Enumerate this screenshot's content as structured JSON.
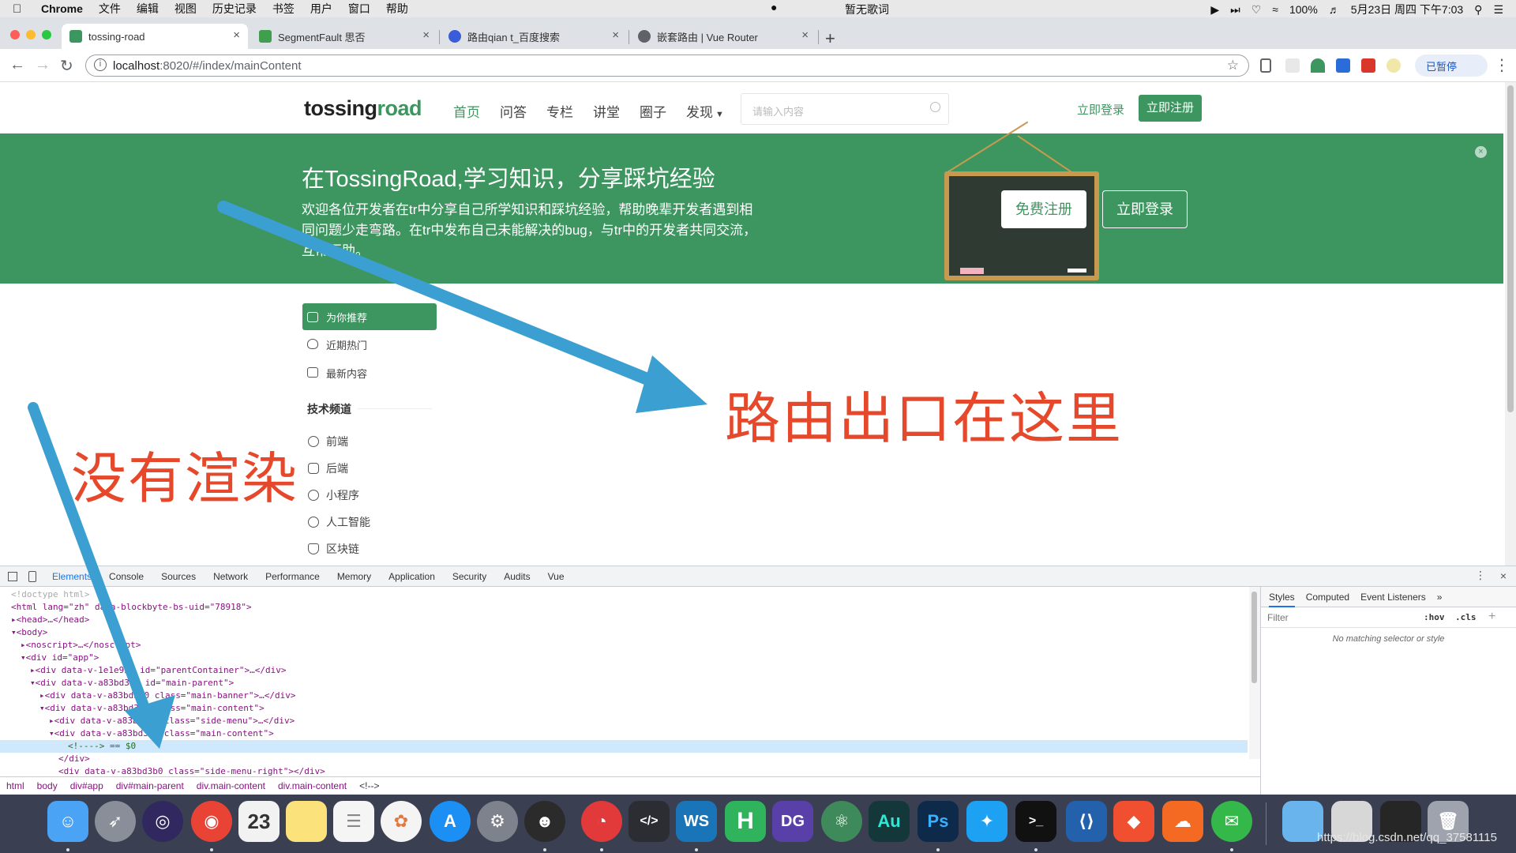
{
  "menubar": {
    "items": [
      "Chrome",
      "文件",
      "编辑",
      "视图",
      "历史记录",
      "书签",
      "用户",
      "窗口",
      "帮助"
    ],
    "center_text": "暂无歌词",
    "battery": "100%",
    "datetime": "5月23日 周四 下午7:03"
  },
  "tabs": [
    {
      "title": "tossing-road",
      "favicon_color": "#3d9660"
    },
    {
      "title": "SegmentFault 思否",
      "favicon_color": "#3f9f4f"
    },
    {
      "title": "路由qian t_百度搜索",
      "favicon_color": "#3b5cd8"
    },
    {
      "title": "嵌套路由 | Vue Router",
      "favicon_color": "#5f6368"
    }
  ],
  "toolbar": {
    "url_host": "localhost",
    "url_path": ":8020/#/index/mainContent",
    "paused_label": "已暂停"
  },
  "site": {
    "logo_dark": "tossing",
    "logo_green": "road",
    "nav": [
      "首页",
      "问答",
      "专栏",
      "讲堂",
      "圈子",
      "发现"
    ],
    "search_placeholder": "请输入内容",
    "login": "立即登录",
    "register": "立即注册",
    "banner_title": "在TossingRoad,学习知识，分享踩坑经验",
    "banner_desc": "欢迎各位开发者在tr中分享自己所学知识和踩坑经验，帮助晚辈开发者遇到相同问题少走弯路。在tr中发布自己未能解决的bug，与tr中的开发者共同交流，互帮互助。",
    "banner_close": "×",
    "free_register": "免费注册",
    "banner_login": "立即登录",
    "menu": [
      "为你推荐",
      "近期热门",
      "最新内容"
    ],
    "channel_heading": "技术频道",
    "channels": [
      "前端",
      "后端",
      "小程序",
      "人工智能",
      "区块链"
    ]
  },
  "annotations": {
    "router_outlet": "路由出口在这里",
    "not_rendered": "没有渲染"
  },
  "devtools": {
    "tabs": [
      "Elements",
      "Console",
      "Sources",
      "Network",
      "Performance",
      "Memory",
      "Application",
      "Security",
      "Audits",
      "Vue"
    ],
    "breadcrumbs": [
      "html",
      "body",
      "div#app",
      "div#main-parent",
      "div.main-content",
      "div.main-content",
      "<!-->"
    ],
    "styles_tabs": [
      "Styles",
      "Computed",
      "Event Listeners",
      "»"
    ],
    "filter_placeholder": "Filter",
    "hov": ":hov",
    "cls": ".cls",
    "empty_text": "No matching selector or style",
    "lines": [
      "<!doctype html>",
      "<html lang=\"zh\" data-blockbyte-bs-uid=\"78918\">",
      "<head>…</head>",
      "<body>",
      "<noscript>…</noscript>",
      "<div id=\"app\">",
      "<div data-v-1e1e932 id=\"parentContainer\">…</div>",
      "<div data-v-a83bd3b0 id=\"main-parent\">",
      "<div data-v-a83bd3b0 class=\"main-banner\">…</div>",
      "<div data-v-a83bd3b0 class=\"main-content\">",
      "<div data-v-a83bd3b0 class=\"side-menu\">…</div>",
      "<div data-v-a83bd3b0 class=\"main-content\">",
      "<!----> == $0",
      "</div>",
      "<div data-v-a83bd3b0 class=\"side-menu-right\"></div>"
    ]
  },
  "watermark": "https://blog.csdn.net/qq_37581115"
}
